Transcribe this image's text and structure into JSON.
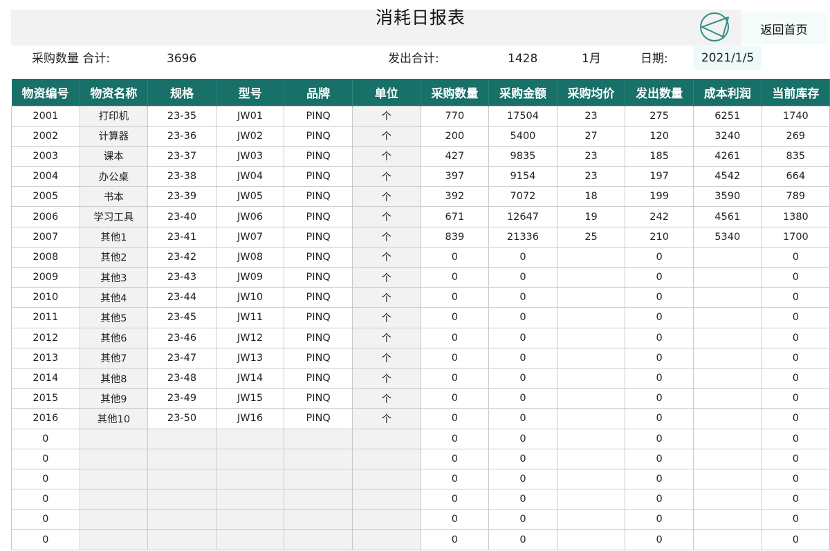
{
  "header": {
    "title": "消耗日报表",
    "back_label": "返回首页",
    "back_icon": "back-arrow-icon"
  },
  "summary": {
    "purchase_total_label": "采购数量 合计:",
    "purchase_total_value": "3696",
    "issue_total_label": "发出合计:",
    "issue_total_value": "1428",
    "month": "1月",
    "date_label": "日期:",
    "date_value": "2021/1/5"
  },
  "colors": {
    "header_bg": "#187068",
    "shade": "#f2f2f2",
    "date_bg": "#eef9f9"
  },
  "table": {
    "columns": [
      "物资编号",
      "物资名称",
      "规格",
      "型号",
      "品牌",
      "单位",
      "采购数量",
      "采购金额",
      "采购均价",
      "发出数量",
      "成本利润",
      "当前库存"
    ],
    "rows": [
      [
        "2001",
        "打印机",
        "23-35",
        "JW01",
        "PINQ",
        "个",
        "770",
        "17504",
        "23",
        "275",
        "6251",
        "1740"
      ],
      [
        "2002",
        "计算器",
        "23-36",
        "JW02",
        "PINQ",
        "个",
        "200",
        "5400",
        "27",
        "120",
        "3240",
        "269"
      ],
      [
        "2003",
        "课本",
        "23-37",
        "JW03",
        "PINQ",
        "个",
        "427",
        "9835",
        "23",
        "185",
        "4261",
        "835"
      ],
      [
        "2004",
        "办公桌",
        "23-38",
        "JW04",
        "PINQ",
        "个",
        "397",
        "9154",
        "23",
        "197",
        "4542",
        "664"
      ],
      [
        "2005",
        "书本",
        "23-39",
        "JW05",
        "PINQ",
        "个",
        "392",
        "7072",
        "18",
        "199",
        "3590",
        "789"
      ],
      [
        "2006",
        "学习工具",
        "23-40",
        "JW06",
        "PINQ",
        "个",
        "671",
        "12647",
        "19",
        "242",
        "4561",
        "1380"
      ],
      [
        "2007",
        "其他1",
        "23-41",
        "JW07",
        "PINQ",
        "个",
        "839",
        "21336",
        "25",
        "210",
        "5340",
        "1700"
      ],
      [
        "2008",
        "其他2",
        "23-42",
        "JW08",
        "PINQ",
        "个",
        "0",
        "0",
        "",
        "0",
        "",
        "0"
      ],
      [
        "2009",
        "其他3",
        "23-43",
        "JW09",
        "PINQ",
        "个",
        "0",
        "0",
        "",
        "0",
        "",
        "0"
      ],
      [
        "2010",
        "其他4",
        "23-44",
        "JW10",
        "PINQ",
        "个",
        "0",
        "0",
        "",
        "0",
        "",
        "0"
      ],
      [
        "2011",
        "其他5",
        "23-45",
        "JW11",
        "PINQ",
        "个",
        "0",
        "0",
        "",
        "0",
        "",
        "0"
      ],
      [
        "2012",
        "其他6",
        "23-46",
        "JW12",
        "PINQ",
        "个",
        "0",
        "0",
        "",
        "0",
        "",
        "0"
      ],
      [
        "2013",
        "其他7",
        "23-47",
        "JW13",
        "PINQ",
        "个",
        "0",
        "0",
        "",
        "0",
        "",
        "0"
      ],
      [
        "2014",
        "其他8",
        "23-48",
        "JW14",
        "PINQ",
        "个",
        "0",
        "0",
        "",
        "0",
        "",
        "0"
      ],
      [
        "2015",
        "其他9",
        "23-49",
        "JW15",
        "PINQ",
        "个",
        "0",
        "0",
        "",
        "0",
        "",
        "0"
      ],
      [
        "2016",
        "其他10",
        "23-50",
        "JW16",
        "PINQ",
        "个",
        "0",
        "0",
        "",
        "0",
        "",
        "0"
      ],
      [
        "0",
        "",
        "",
        "",
        "",
        "",
        "0",
        "0",
        "",
        "0",
        "",
        "0"
      ],
      [
        "0",
        "",
        "",
        "",
        "",
        "",
        "0",
        "0",
        "",
        "0",
        "",
        "0"
      ],
      [
        "0",
        "",
        "",
        "",
        "",
        "",
        "0",
        "0",
        "",
        "0",
        "",
        "0"
      ],
      [
        "0",
        "",
        "",
        "",
        "",
        "",
        "0",
        "0",
        "",
        "0",
        "",
        "0"
      ],
      [
        "0",
        "",
        "",
        "",
        "",
        "",
        "0",
        "0",
        "",
        "0",
        "",
        "0"
      ],
      [
        "0",
        "",
        "",
        "",
        "",
        "",
        "0",
        "0",
        "",
        "0",
        "",
        "0"
      ]
    ]
  }
}
